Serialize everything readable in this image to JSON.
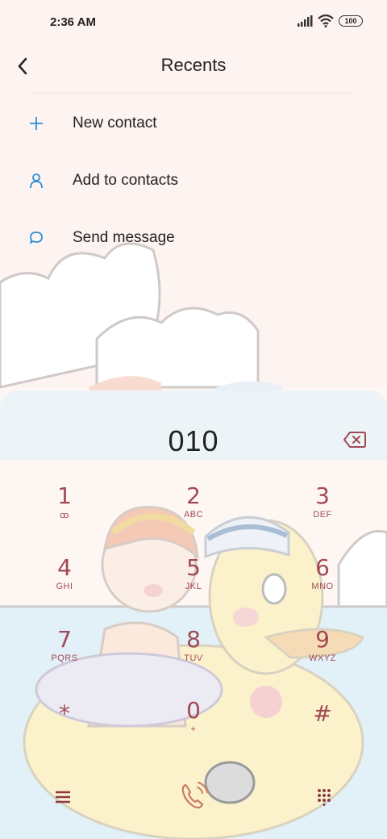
{
  "status_bar": {
    "time": "2:36 AM",
    "battery": "100",
    "icons": [
      "signal-icon",
      "wifi-icon",
      "battery-icon"
    ]
  },
  "header": {
    "title": "Recents",
    "back_icon": "back-arrow-icon"
  },
  "menu": {
    "items": [
      {
        "icon": "plus-icon",
        "label": "New contact"
      },
      {
        "icon": "person-icon",
        "label": "Add to contacts"
      },
      {
        "icon": "chat-bubble-icon",
        "label": "Send message"
      }
    ]
  },
  "dialer": {
    "number": "010",
    "keys": [
      {
        "digit": "1",
        "letters": "ꝏ"
      },
      {
        "digit": "2",
        "letters": "ABC"
      },
      {
        "digit": "3",
        "letters": "DEF"
      },
      {
        "digit": "4",
        "letters": "GHI"
      },
      {
        "digit": "5",
        "letters": "JKL"
      },
      {
        "digit": "6",
        "letters": "MNO"
      },
      {
        "digit": "7",
        "letters": "PQRS"
      },
      {
        "digit": "8",
        "letters": "TUV"
      },
      {
        "digit": "9",
        "letters": "WXYZ"
      },
      {
        "digit": "*",
        "letters": ""
      },
      {
        "digit": "0",
        "letters": "+"
      },
      {
        "digit": "#",
        "letters": ""
      }
    ]
  },
  "bottom_bar": {
    "left_icon": "menu-icon",
    "center_icon": "call-icon",
    "right_icon": "keypad-icon"
  },
  "colors": {
    "accent": "#2b8fd8",
    "key_text": "#a04a55",
    "call_icon": "#c97a66"
  }
}
